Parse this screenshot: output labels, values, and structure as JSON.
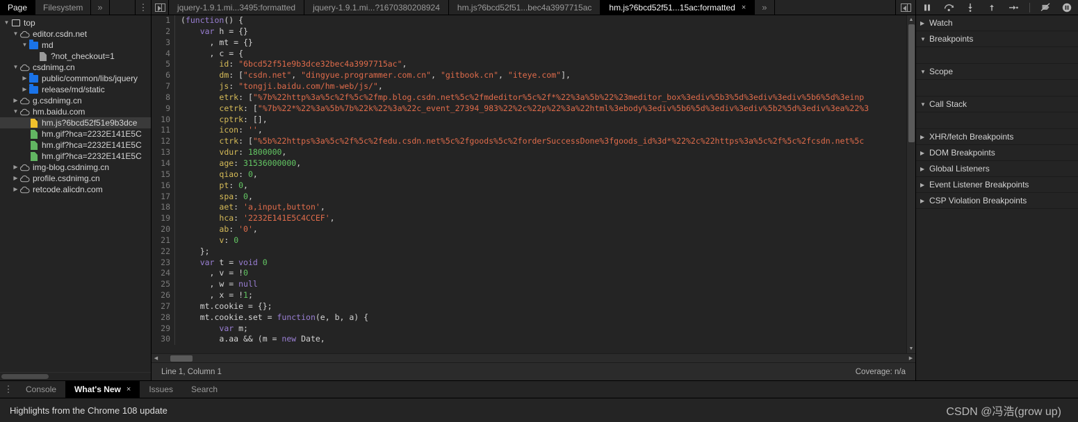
{
  "navigator": {
    "tabs": [
      {
        "label": "Page",
        "active": true
      },
      {
        "label": "Filesystem",
        "active": false
      }
    ],
    "more_label": "»",
    "menu_label": "⋮",
    "tree": [
      {
        "indent": 0,
        "twisty": "▼",
        "icon": "frame-icon",
        "label": "top"
      },
      {
        "indent": 1,
        "twisty": "▼",
        "icon": "cloud-icon",
        "label": "editor.csdn.net"
      },
      {
        "indent": 2,
        "twisty": "▼",
        "icon": "folder-icon",
        "label": "md"
      },
      {
        "indent": 3,
        "twisty": "",
        "icon": "document-grey-icon",
        "label": "?not_checkout=1"
      },
      {
        "indent": 1,
        "twisty": "▼",
        "icon": "cloud-icon",
        "label": "csdnimg.cn"
      },
      {
        "indent": 2,
        "twisty": "▶",
        "icon": "folder-icon",
        "label": "public/common/libs/jquery"
      },
      {
        "indent": 2,
        "twisty": "▶",
        "icon": "folder-icon",
        "label": "release/md/static"
      },
      {
        "indent": 1,
        "twisty": "▶",
        "icon": "cloud-icon",
        "label": "g.csdnimg.cn"
      },
      {
        "indent": 1,
        "twisty": "▼",
        "icon": "cloud-icon",
        "label": "hm.baidu.com"
      },
      {
        "indent": 2,
        "twisty": "",
        "icon": "document-yellow-icon",
        "label": "hm.js?6bcd52f51e9b3dce",
        "selected": true
      },
      {
        "indent": 2,
        "twisty": "",
        "icon": "document-green-icon",
        "label": "hm.gif?hca=2232E141E5C"
      },
      {
        "indent": 2,
        "twisty": "",
        "icon": "document-green-icon",
        "label": "hm.gif?hca=2232E141E5C"
      },
      {
        "indent": 2,
        "twisty": "",
        "icon": "document-green-icon",
        "label": "hm.gif?hca=2232E141E5C"
      },
      {
        "indent": 1,
        "twisty": "▶",
        "icon": "cloud-icon",
        "label": "img-blog.csdnimg.cn"
      },
      {
        "indent": 1,
        "twisty": "▶",
        "icon": "cloud-icon",
        "label": "profile.csdnimg.cn"
      },
      {
        "indent": 1,
        "twisty": "▶",
        "icon": "cloud-icon",
        "label": "retcode.alicdn.com"
      }
    ]
  },
  "source": {
    "tabs": [
      {
        "label": "jquery-1.9.1.mi...3495:formatted",
        "active": false,
        "closable": false
      },
      {
        "label": "jquery-1.9.1.mi...?1670380208924",
        "active": false,
        "closable": false
      },
      {
        "label": "hm.js?6bcd52f51...bec4a3997715ac",
        "active": false,
        "closable": false
      },
      {
        "label": "hm.js?6bcd52f51...15ac:formatted",
        "active": true,
        "closable": true
      }
    ],
    "close_glyph": "×",
    "more_glyph": "»",
    "code_lines": [
      {
        "n": 1,
        "tokens": [
          {
            "t": "(",
            "c": "punc"
          },
          {
            "t": "function",
            "c": "kw"
          },
          {
            "t": "() {",
            "c": "punc"
          }
        ]
      },
      {
        "n": 2,
        "tokens": [
          {
            "t": "    ",
            "c": "plain"
          },
          {
            "t": "var",
            "c": "kw"
          },
          {
            "t": " h = {}",
            "c": "plain"
          }
        ]
      },
      {
        "n": 3,
        "tokens": [
          {
            "t": "      , mt = {}",
            "c": "plain"
          }
        ]
      },
      {
        "n": 4,
        "tokens": [
          {
            "t": "      , c = {",
            "c": "plain"
          }
        ]
      },
      {
        "n": 5,
        "tokens": [
          {
            "t": "        ",
            "c": "plain"
          },
          {
            "t": "id",
            "c": "prop"
          },
          {
            "t": ": ",
            "c": "plain"
          },
          {
            "t": "\"6bcd52f51e9b3dce32bec4a3997715ac\"",
            "c": "str"
          },
          {
            "t": ",",
            "c": "plain"
          }
        ]
      },
      {
        "n": 6,
        "tokens": [
          {
            "t": "        ",
            "c": "plain"
          },
          {
            "t": "dm",
            "c": "prop"
          },
          {
            "t": ": [",
            "c": "plain"
          },
          {
            "t": "\"csdn.net\"",
            "c": "str"
          },
          {
            "t": ", ",
            "c": "plain"
          },
          {
            "t": "\"dingyue.programmer.com.cn\"",
            "c": "str"
          },
          {
            "t": ", ",
            "c": "plain"
          },
          {
            "t": "\"gitbook.cn\"",
            "c": "str"
          },
          {
            "t": ", ",
            "c": "plain"
          },
          {
            "t": "\"iteye.com\"",
            "c": "str"
          },
          {
            "t": "],",
            "c": "plain"
          }
        ]
      },
      {
        "n": 7,
        "tokens": [
          {
            "t": "        ",
            "c": "plain"
          },
          {
            "t": "js",
            "c": "prop"
          },
          {
            "t": ": ",
            "c": "plain"
          },
          {
            "t": "\"tongji.baidu.com/hm-web/js/\"",
            "c": "str"
          },
          {
            "t": ",",
            "c": "plain"
          }
        ]
      },
      {
        "n": 8,
        "tokens": [
          {
            "t": "        ",
            "c": "plain"
          },
          {
            "t": "etrk",
            "c": "prop"
          },
          {
            "t": ": [",
            "c": "plain"
          },
          {
            "t": "\"%7b%22http%3a%5c%2f%5c%2fmp.blog.csdn.net%5c%2fmdeditor%5c%2f*%22%3a%5b%22%23meditor_box%3ediv%5b3%5d%3ediv%3ediv%5b6%5d%3einp",
            "c": "str"
          }
        ]
      },
      {
        "n": 9,
        "tokens": [
          {
            "t": "        ",
            "c": "plain"
          },
          {
            "t": "cetrk",
            "c": "prop"
          },
          {
            "t": ": [",
            "c": "plain"
          },
          {
            "t": "\"%7b%22*%22%3a%5b%7b%22k%22%3a%22c_event_27394_983%22%2c%22p%22%3a%22html%3ebody%3ediv%5b6%5d%3ediv%3ediv%5b2%5d%3ediv%3ea%22%3",
            "c": "str"
          }
        ]
      },
      {
        "n": 10,
        "tokens": [
          {
            "t": "        ",
            "c": "plain"
          },
          {
            "t": "cptrk",
            "c": "prop"
          },
          {
            "t": ": [],",
            "c": "plain"
          }
        ]
      },
      {
        "n": 11,
        "tokens": [
          {
            "t": "        ",
            "c": "plain"
          },
          {
            "t": "icon",
            "c": "prop"
          },
          {
            "t": ": ",
            "c": "plain"
          },
          {
            "t": "''",
            "c": "str"
          },
          {
            "t": ",",
            "c": "plain"
          }
        ]
      },
      {
        "n": 12,
        "tokens": [
          {
            "t": "        ",
            "c": "plain"
          },
          {
            "t": "ctrk",
            "c": "prop"
          },
          {
            "t": ": [",
            "c": "plain"
          },
          {
            "t": "\"%5b%22https%3a%5c%2f%5c%2fedu.csdn.net%5c%2fgoods%5c%2forderSuccessDone%3fgoods_id%3d*%22%2c%22https%3a%5c%2f%5c%2fcsdn.net%5c",
            "c": "str"
          }
        ]
      },
      {
        "n": 13,
        "tokens": [
          {
            "t": "        ",
            "c": "plain"
          },
          {
            "t": "vdur",
            "c": "prop"
          },
          {
            "t": ": ",
            "c": "plain"
          },
          {
            "t": "1800000",
            "c": "num"
          },
          {
            "t": ",",
            "c": "plain"
          }
        ]
      },
      {
        "n": 14,
        "tokens": [
          {
            "t": "        ",
            "c": "plain"
          },
          {
            "t": "age",
            "c": "prop"
          },
          {
            "t": ": ",
            "c": "plain"
          },
          {
            "t": "31536000000",
            "c": "num"
          },
          {
            "t": ",",
            "c": "plain"
          }
        ]
      },
      {
        "n": 15,
        "tokens": [
          {
            "t": "        ",
            "c": "plain"
          },
          {
            "t": "qiao",
            "c": "prop"
          },
          {
            "t": ": ",
            "c": "plain"
          },
          {
            "t": "0",
            "c": "num"
          },
          {
            "t": ",",
            "c": "plain"
          }
        ]
      },
      {
        "n": 16,
        "tokens": [
          {
            "t": "        ",
            "c": "plain"
          },
          {
            "t": "pt",
            "c": "prop"
          },
          {
            "t": ": ",
            "c": "plain"
          },
          {
            "t": "0",
            "c": "num"
          },
          {
            "t": ",",
            "c": "plain"
          }
        ]
      },
      {
        "n": 17,
        "tokens": [
          {
            "t": "        ",
            "c": "plain"
          },
          {
            "t": "spa",
            "c": "prop"
          },
          {
            "t": ": ",
            "c": "plain"
          },
          {
            "t": "0",
            "c": "num"
          },
          {
            "t": ",",
            "c": "plain"
          }
        ]
      },
      {
        "n": 18,
        "tokens": [
          {
            "t": "        ",
            "c": "plain"
          },
          {
            "t": "aet",
            "c": "prop"
          },
          {
            "t": ": ",
            "c": "plain"
          },
          {
            "t": "'a,input,button'",
            "c": "str"
          },
          {
            "t": ",",
            "c": "plain"
          }
        ]
      },
      {
        "n": 19,
        "tokens": [
          {
            "t": "        ",
            "c": "plain"
          },
          {
            "t": "hca",
            "c": "prop"
          },
          {
            "t": ": ",
            "c": "plain"
          },
          {
            "t": "'2232E141E5C4CCEF'",
            "c": "str"
          },
          {
            "t": ",",
            "c": "plain"
          }
        ]
      },
      {
        "n": 20,
        "tokens": [
          {
            "t": "        ",
            "c": "plain"
          },
          {
            "t": "ab",
            "c": "prop"
          },
          {
            "t": ": ",
            "c": "plain"
          },
          {
            "t": "'0'",
            "c": "str"
          },
          {
            "t": ",",
            "c": "plain"
          }
        ]
      },
      {
        "n": 21,
        "tokens": [
          {
            "t": "        ",
            "c": "plain"
          },
          {
            "t": "v",
            "c": "prop"
          },
          {
            "t": ": ",
            "c": "plain"
          },
          {
            "t": "0",
            "c": "num"
          }
        ]
      },
      {
        "n": 22,
        "tokens": [
          {
            "t": "    };",
            "c": "plain"
          }
        ]
      },
      {
        "n": 23,
        "tokens": [
          {
            "t": "    ",
            "c": "plain"
          },
          {
            "t": "var",
            "c": "kw"
          },
          {
            "t": " t = ",
            "c": "plain"
          },
          {
            "t": "void",
            "c": "kw"
          },
          {
            "t": " ",
            "c": "plain"
          },
          {
            "t": "0",
            "c": "num"
          }
        ]
      },
      {
        "n": 24,
        "tokens": [
          {
            "t": "      , v = !",
            "c": "plain"
          },
          {
            "t": "0",
            "c": "num"
          }
        ]
      },
      {
        "n": 25,
        "tokens": [
          {
            "t": "      , w = ",
            "c": "plain"
          },
          {
            "t": "null",
            "c": "kw"
          }
        ]
      },
      {
        "n": 26,
        "tokens": [
          {
            "t": "      , x = !",
            "c": "plain"
          },
          {
            "t": "1",
            "c": "num"
          },
          {
            "t": ";",
            "c": "plain"
          }
        ]
      },
      {
        "n": 27,
        "tokens": [
          {
            "t": "    mt.cookie = {};",
            "c": "plain"
          }
        ]
      },
      {
        "n": 28,
        "tokens": [
          {
            "t": "    mt.cookie.set = ",
            "c": "plain"
          },
          {
            "t": "function",
            "c": "kw"
          },
          {
            "t": "(e, b, a) {",
            "c": "plain"
          }
        ]
      },
      {
        "n": 29,
        "tokens": [
          {
            "t": "        ",
            "c": "plain"
          },
          {
            "t": "var",
            "c": "kw"
          },
          {
            "t": " m;",
            "c": "plain"
          }
        ]
      },
      {
        "n": 30,
        "tokens": [
          {
            "t": "        a.aa && (m = ",
            "c": "plain"
          },
          {
            "t": "new",
            "c": "kw"
          },
          {
            "t": " Date,",
            "c": "plain"
          }
        ]
      }
    ],
    "status": {
      "position": "Line 1, Column 1",
      "coverage": "Coverage: n/a"
    }
  },
  "debugger": {
    "toolbar": [
      {
        "name": "resume-script-execution",
        "glyph": "pause"
      },
      {
        "name": "step-over-next-function-call",
        "glyph": "step-over"
      },
      {
        "name": "step-into-next-function-call",
        "glyph": "step-into"
      },
      {
        "name": "step-out-of-current-function",
        "glyph": "step-out"
      },
      {
        "name": "step",
        "glyph": "step"
      },
      {
        "name": "deactivate-breakpoints",
        "glyph": "deactivate"
      },
      {
        "name": "pause-on-exceptions",
        "glyph": "pause-circle"
      }
    ],
    "sections": [
      {
        "label": "Watch",
        "expanded": false,
        "body": false
      },
      {
        "label": "Breakpoints",
        "expanded": true,
        "body": true
      },
      {
        "label": "Scope",
        "expanded": true,
        "body": true
      },
      {
        "label": "Call Stack",
        "expanded": true,
        "body": true
      },
      {
        "label": "XHR/fetch Breakpoints",
        "expanded": false,
        "body": false
      },
      {
        "label": "DOM Breakpoints",
        "expanded": false,
        "body": false
      },
      {
        "label": "Global Listeners",
        "expanded": false,
        "body": false
      },
      {
        "label": "Event Listener Breakpoints",
        "expanded": false,
        "body": false
      },
      {
        "label": "CSP Violation Breakpoints",
        "expanded": false,
        "body": false
      }
    ],
    "expanded_glyph": "▼",
    "collapsed_glyph": "▶"
  },
  "drawer": {
    "menu_glyph": "⋮",
    "tabs": [
      {
        "label": "Console",
        "active": false,
        "closable": false
      },
      {
        "label": "What's New",
        "active": true,
        "closable": true
      },
      {
        "label": "Issues",
        "active": false,
        "closable": false
      },
      {
        "label": "Search",
        "active": false,
        "closable": false
      }
    ],
    "close_glyph": "×",
    "content_title": "Highlights from the Chrome 108 update"
  },
  "watermark": "CSDN @冯浩(grow up)",
  "colors": {
    "background": "#242424",
    "active_tab": "#000000",
    "folder_blue": "#1a73e8",
    "doc_yellow": "#f0c02c",
    "doc_green": "#62b562",
    "string_orange": "#e06c4b",
    "keyword_purple": "#9a7fd4",
    "number_green": "#64c864",
    "property_yellow": "#d6bb58"
  }
}
